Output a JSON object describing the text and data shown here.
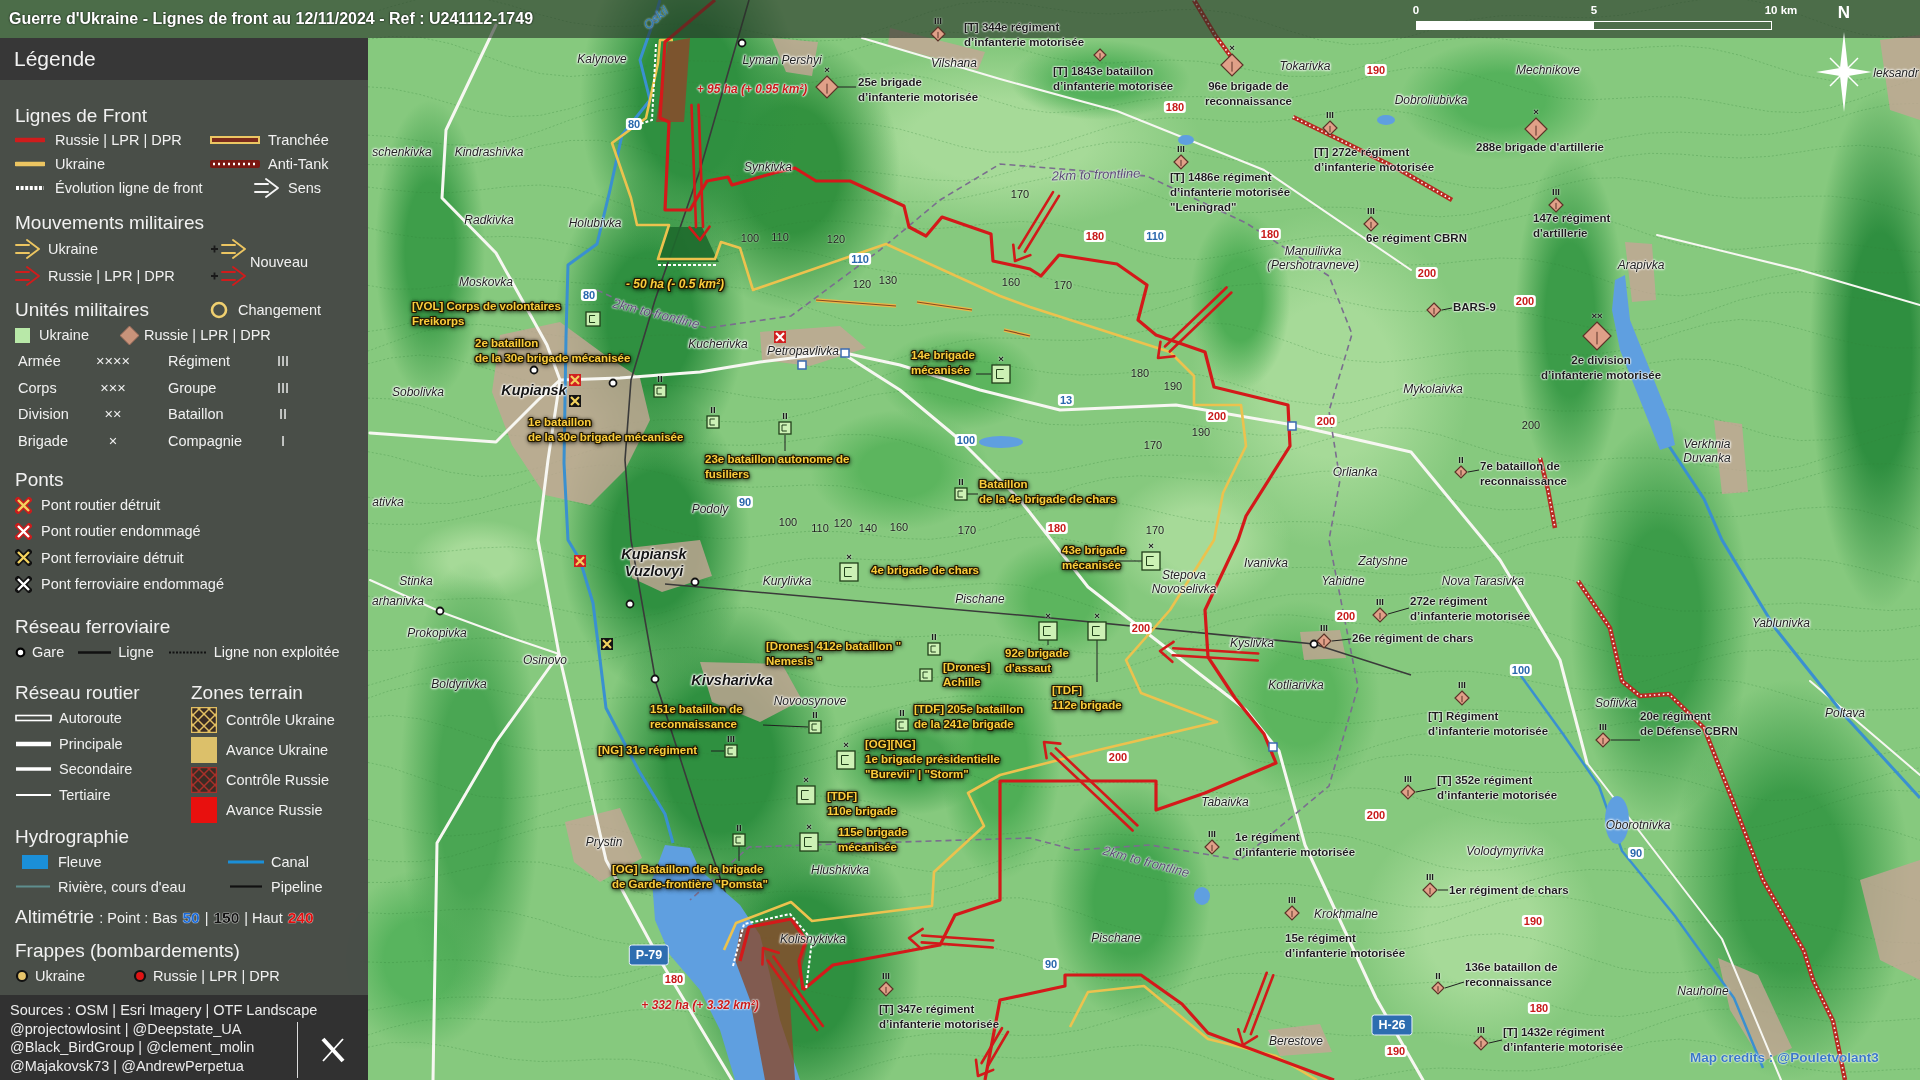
{
  "header": {
    "title": "Guerre d'Ukraine - Lignes de front au 12/11/2024 - Ref : U241112-1749",
    "scale_labels": [
      "0",
      "5",
      "10 km"
    ],
    "north_label": "N"
  },
  "legend": {
    "title": "Légende",
    "front_lines": {
      "heading": "Lignes de Front",
      "items": [
        {
          "label": "Russie | LPR | DPR",
          "kind": "line",
          "color": "#d01c1c"
        },
        {
          "label": "Tranchée",
          "kind": "trench"
        },
        {
          "label": "Ukraine",
          "kind": "line",
          "color": "#ecc561"
        },
        {
          "label": "Anti-Tank",
          "kind": "antitank"
        },
        {
          "label": "Évolution ligne de front",
          "kind": "dotted"
        },
        {
          "label": "Sens",
          "kind": "arrow"
        }
      ]
    },
    "movements": {
      "heading": "Mouvements militaires",
      "items": [
        {
          "label": "Ukraine",
          "color": "#ecc561"
        },
        {
          "label": "Russie | LPR | DPR",
          "color": "#d01c1c"
        }
      ],
      "new_label": "Nouveau"
    },
    "units": {
      "heading": "Unités militaires",
      "change_label": "Changement",
      "sides": [
        {
          "label": "Ukraine",
          "kind": "square"
        },
        {
          "label": "Russie | LPR | DPR",
          "kind": "diamond"
        }
      ],
      "echelons": [
        {
          "name": "Armée",
          "mark": "××××"
        },
        {
          "name": "Régiment",
          "mark": "III"
        },
        {
          "name": "Corps",
          "mark": "×××"
        },
        {
          "name": "Groupe",
          "mark": "III"
        },
        {
          "name": "Division",
          "mark": "××"
        },
        {
          "name": "Bataillon",
          "mark": "II"
        },
        {
          "name": "Brigade",
          "mark": "×"
        },
        {
          "name": "Compagnie",
          "mark": "I"
        }
      ]
    },
    "bridges": {
      "heading": "Ponts",
      "items": [
        {
          "label": "Pont routier détruit",
          "kind": "road",
          "destroyed": true
        },
        {
          "label": "Pont routier endommagé",
          "kind": "road",
          "destroyed": false
        },
        {
          "label": "Pont ferroviaire détruit",
          "kind": "rail",
          "destroyed": true
        },
        {
          "label": "Pont ferroviaire endommagé",
          "kind": "rail",
          "destroyed": false
        }
      ]
    },
    "railway": {
      "heading": "Réseau ferroviaire",
      "items": [
        {
          "label": "Gare",
          "kind": "station"
        },
        {
          "label": "Ligne",
          "kind": "line"
        },
        {
          "label": "Ligne non exploitée",
          "kind": "dashed"
        }
      ]
    },
    "roads": {
      "heading": "Réseau routier",
      "items": [
        {
          "label": "Autoroute",
          "kind": "motorway"
        },
        {
          "label": "Principale",
          "kind": "primary"
        },
        {
          "label": "Secondaire",
          "kind": "secondary"
        },
        {
          "label": "Tertiaire",
          "kind": "tertiary"
        }
      ]
    },
    "zones": {
      "heading": "Zones terrain",
      "items": [
        {
          "label": "Contrôle Ukraine",
          "kind": "hatched",
          "color": "#e2bf62"
        },
        {
          "label": "Avance Ukraine",
          "kind": "solid",
          "color": "#dcc06a"
        },
        {
          "label": "Contrôle Russie",
          "kind": "hatched",
          "color": "#a8302a"
        },
        {
          "label": "Avance Russie",
          "kind": "solid",
          "color": "#e8100e"
        }
      ]
    },
    "hydro": {
      "heading": "Hydrographie",
      "items": [
        {
          "label": "Fleuve",
          "kind": "area"
        },
        {
          "label": "Canal",
          "kind": "canal"
        },
        {
          "label": "Rivière, cours d'eau",
          "kind": "stream"
        },
        {
          "label": "Pipeline",
          "kind": "pipeline"
        }
      ]
    },
    "elevation": {
      "heading": "Altimétrie",
      "parts": [
        {
          "text": ": Point : Bas",
          "kind": "plain"
        },
        {
          "text": "50",
          "kind": "low"
        },
        {
          "text": "|",
          "kind": "plain"
        },
        {
          "text": "150",
          "kind": "mid"
        },
        {
          "text": "| Haut",
          "kind": "plain"
        },
        {
          "text": "240",
          "kind": "high"
        }
      ]
    },
    "strikes": {
      "heading": "Frappes (bombardements)",
      "items": [
        {
          "label": "Ukraine",
          "color": "#e6c46a"
        },
        {
          "label": "Russie | LPR | DPR",
          "color": "#e01414"
        }
      ]
    },
    "sources": {
      "text": "Sources : OSM | Esri Imagery | OTF Landscape",
      "credits": [
        "@projectowlosint | @Deepstate_UA",
        "@Black_BirdGroup | @clement_molin",
        "@Majakovsk73 | @AndrewPerpetua"
      ]
    }
  },
  "map": {
    "places": [
      {
        "name": "Kalynove",
        "kind": "village"
      },
      {
        "name": "Lyman Pershyi",
        "kind": "village"
      },
      {
        "name": "Vilshana",
        "kind": "village"
      },
      {
        "name": "Tokarivka",
        "kind": "village"
      },
      {
        "name": "Mechnikove",
        "kind": "village"
      },
      {
        "name": "leksandr",
        "kind": "village"
      },
      {
        "name": "Dobroliubivka",
        "kind": "village"
      },
      {
        "name": "schenkivka",
        "kind": "village"
      },
      {
        "name": "Kindrashivka",
        "kind": "village"
      },
      {
        "name": "Synkivka",
        "kind": "village"
      },
      {
        "name": "Radkivka",
        "kind": "village"
      },
      {
        "name": "Holubivka",
        "kind": "village"
      },
      {
        "name": "Manuilivka\n(Pershotravneve)",
        "kind": "village"
      },
      {
        "name": "Arapivka",
        "kind": "village"
      },
      {
        "name": "Moskovka",
        "kind": "village"
      },
      {
        "name": "Kucherivka",
        "kind": "village"
      },
      {
        "name": "Petropavlivka",
        "kind": "village"
      },
      {
        "name": "Sobolivka",
        "kind": "village"
      },
      {
        "name": "Kupiansk",
        "kind": "city"
      },
      {
        "name": "Mykolaivka",
        "kind": "village"
      },
      {
        "name": "Verkhnia\nDuvanka",
        "kind": "village"
      },
      {
        "name": "Orlianka",
        "kind": "village"
      },
      {
        "name": "ativka",
        "kind": "village"
      },
      {
        "name": "Podoly",
        "kind": "village"
      },
      {
        "name": "Kupiansk\nVuzlovyi",
        "kind": "city"
      },
      {
        "name": "Ivanivka",
        "kind": "village"
      },
      {
        "name": "Zatyshne",
        "kind": "village"
      },
      {
        "name": "Stinka",
        "kind": "village"
      },
      {
        "name": "Kurylivka",
        "kind": "village"
      },
      {
        "name": "Stepova\nNovoselivka",
        "kind": "village"
      },
      {
        "name": "Yahidne",
        "kind": "village"
      },
      {
        "name": "Nova Tarasivka",
        "kind": "village"
      },
      {
        "name": "arhanivka",
        "kind": "village"
      },
      {
        "name": "Pischane",
        "kind": "village"
      },
      {
        "name": "Yablunivka",
        "kind": "village"
      },
      {
        "name": "Prokopivka",
        "kind": "village"
      },
      {
        "name": "Kyslivka",
        "kind": "village"
      },
      {
        "name": "Osinovo",
        "kind": "village"
      },
      {
        "name": "Boldyrivka",
        "kind": "village"
      },
      {
        "name": "Kivsharivka",
        "kind": "city"
      },
      {
        "name": "Kotliarivka",
        "kind": "village"
      },
      {
        "name": "Novoosynove",
        "kind": "village"
      },
      {
        "name": "Sofiivka",
        "kind": "village"
      },
      {
        "name": "Poltava",
        "kind": "village"
      },
      {
        "name": "Tabaivka",
        "kind": "village"
      },
      {
        "name": "Oborotnivka",
        "kind": "village"
      },
      {
        "name": "Prystin",
        "kind": "village"
      },
      {
        "name": "Volodymyrivka",
        "kind": "village"
      },
      {
        "name": "Hlushkivka",
        "kind": "village"
      },
      {
        "name": "Krokhmalne",
        "kind": "village"
      },
      {
        "name": "Kolisnykivka",
        "kind": "village"
      },
      {
        "name": "Pischane",
        "kind": "village"
      },
      {
        "name": "Nauholne",
        "kind": "village"
      },
      {
        "name": "Berestove",
        "kind": "village"
      }
    ],
    "rivers": [
      {
        "name": "Oskil"
      }
    ],
    "russian_units": [
      {
        "label": "[T] 344e régiment\nd’infanterie motorisée",
        "echelon": "III",
        "kind": "regiment"
      },
      {
        "label": "25e brigade\nd’infanterie motorisée",
        "echelon": "×",
        "kind": "brigade"
      },
      {
        "label": "[T] 1843e bataillon\nd’infanterie motorisée",
        "kind": "battalion"
      },
      {
        "label": "96e brigade de\nreconnaissance",
        "echelon": "×",
        "kind": "brigade"
      },
      {
        "label": "[T] 272e régiment\nd’infanterie motorisée",
        "echelon": "III",
        "kind": "regiment"
      },
      {
        "label": "288e brigade d'artillerie",
        "echelon": "×",
        "kind": "brigade"
      },
      {
        "label": "[T] 1486e régiment\nd’infanterie motorisée\n\"Leningrad\"",
        "echelon": "III",
        "kind": "regiment"
      },
      {
        "label": "6e régiment CBRN",
        "echelon": "III",
        "kind": "regiment"
      },
      {
        "label": "147e régiment\nd'artillerie",
        "echelon": "III",
        "kind": "regiment"
      },
      {
        "label": "BARS-9",
        "kind": "detachment"
      },
      {
        "label": "2e division\nd’infanterie motorisée",
        "echelon": "××",
        "kind": "division"
      },
      {
        "label": "7e bataillon de\nreconnaissance",
        "echelon": "II",
        "kind": "battalion"
      },
      {
        "label": "272e régiment\nd’infanterie motorisée",
        "echelon": "III",
        "kind": "regiment"
      },
      {
        "label": "26e régiment de chars",
        "echelon": "III",
        "kind": "regiment"
      },
      {
        "label": "[T] Régiment\nd’infanterie motorisée",
        "echelon": "III",
        "kind": "regiment"
      },
      {
        "label": "20e régiment\nde Défense CBRN",
        "echelon": "III",
        "kind": "regiment"
      },
      {
        "label": "[T] 352e régiment\nd’infanterie motorisée",
        "echelon": "III",
        "kind": "regiment"
      },
      {
        "label": "1e régiment\nd’infanterie motorisée",
        "echelon": "III",
        "kind": "regiment"
      },
      {
        "label": "1er régiment de chars",
        "echelon": "III",
        "kind": "regiment"
      },
      {
        "label": "15e régiment\nd’infanterie motorisée",
        "echelon": "III",
        "kind": "regiment"
      },
      {
        "label": "136e bataillon de\nreconnaissance",
        "echelon": "II",
        "kind": "battalion"
      },
      {
        "label": "[T] 347e régiment\nd’infanterie motorisée",
        "echelon": "III",
        "kind": "regiment"
      },
      {
        "label": "[T] 1432e régiment\nd’infanterie motorisée",
        "echelon": "III",
        "kind": "regiment"
      }
    ],
    "ukrainian_units": [
      {
        "label": "[VOL] Corps de volontaires\nFreikorps",
        "kind": "detachment"
      },
      {
        "label": "2e bataillon\nde la 30e brigade mécanisée",
        "echelon": "II",
        "kind": "battalion"
      },
      {
        "label": "14e brigade\nmécanisée",
        "echelon": "×",
        "kind": "brigade"
      },
      {
        "label": "1e bataillon\nde la 30e brigade mécanisée",
        "echelon": "II",
        "kind": "battalion"
      },
      {
        "label": "23e bataillon autonome de\nfusiliers",
        "echelon": "II",
        "kind": "battalion"
      },
      {
        "label": "Bataillon\nde la 4e brigade de chars",
        "echelon": "II",
        "kind": "battalion"
      },
      {
        "label": "4e brigade de chars",
        "echelon": "×",
        "kind": "brigade"
      },
      {
        "label": "43e brigade\nmécanisée",
        "echelon": "×",
        "kind": "brigade"
      },
      {
        "label": "[Drones] 412e bataillon \"\nNemesis \"",
        "echelon": "II",
        "kind": "battalion"
      },
      {
        "label": "[Drones]\nAchille",
        "kind": "battalion"
      },
      {
        "label": "92e brigade\nd'assaut",
        "echelon": "×",
        "kind": "brigade"
      },
      {
        "label": "[TDF]\n112e brigade",
        "echelon": "×",
        "kind": "brigade"
      },
      {
        "label": "151e bataillon de\nreconnaissance",
        "echelon": "II",
        "kind": "battalion"
      },
      {
        "label": "[TDF] 205e bataillon\nde la 241e brigade",
        "echelon": "II",
        "kind": "battalion"
      },
      {
        "label": "[NG] 31e régiment",
        "echelon": "III",
        "kind": "regiment"
      },
      {
        "label": "[OG][NG]\n1e brigade présidentielle\n\"Burevii\" | \"Storm\"",
        "echelon": "×",
        "kind": "brigade"
      },
      {
        "label": "[TDF]\n110e brigade",
        "echelon": "×",
        "kind": "brigade"
      },
      {
        "label": "[OG] Bataillon de la brigade\nde Garde-frontière \"Pomsta\"",
        "echelon": "II",
        "kind": "battalion"
      },
      {
        "label": "115e brigade\nmécanisée",
        "echelon": "×",
        "kind": "brigade"
      }
    ],
    "area_changes": [
      {
        "text": "+ 95 ha (+ 0.95 km²)",
        "kind": "russia"
      },
      {
        "text": "- 50 ha (- 0.5 km²)",
        "kind": "ukraine"
      },
      {
        "text": "+ 332 ha (+ 3.32 km²)",
        "kind": "russia"
      }
    ],
    "distance_labels": [
      "2km to frontline",
      "2km to frontline",
      "2km to frontline"
    ],
    "elevations": [
      {
        "value": "190",
        "kind": "high"
      },
      {
        "value": "180",
        "kind": "high"
      },
      {
        "value": "80",
        "kind": "low"
      },
      {
        "value": "170",
        "kind": "mid"
      },
      {
        "value": "100",
        "kind": "mid"
      },
      {
        "value": "110",
        "kind": "mid"
      },
      {
        "value": "120",
        "kind": "mid"
      },
      {
        "value": "180",
        "kind": "high"
      },
      {
        "value": "110",
        "kind": "low"
      },
      {
        "value": "180",
        "kind": "high"
      },
      {
        "value": "110",
        "kind": "low"
      },
      {
        "value": "200",
        "kind": "high"
      },
      {
        "value": "120",
        "kind": "mid"
      },
      {
        "value": "130",
        "kind": "mid"
      },
      {
        "value": "160",
        "kind": "mid"
      },
      {
        "value": "170",
        "kind": "mid"
      },
      {
        "value": "80",
        "kind": "low"
      },
      {
        "value": "200",
        "kind": "high"
      },
      {
        "value": "180",
        "kind": "mid"
      },
      {
        "value": "190",
        "kind": "mid"
      },
      {
        "value": "13",
        "kind": "low"
      },
      {
        "value": "200",
        "kind": "high"
      },
      {
        "value": "200",
        "kind": "high"
      },
      {
        "value": "200",
        "kind": "mid"
      },
      {
        "value": "190",
        "kind": "mid"
      },
      {
        "value": "100",
        "kind": "low"
      },
      {
        "value": "170",
        "kind": "mid"
      },
      {
        "value": "90",
        "kind": "low"
      },
      {
        "value": "100",
        "kind": "mid"
      },
      {
        "value": "110",
        "kind": "mid"
      },
      {
        "value": "120",
        "kind": "mid"
      },
      {
        "value": "140",
        "kind": "mid"
      },
      {
        "value": "160",
        "kind": "mid"
      },
      {
        "value": "170",
        "kind": "mid"
      },
      {
        "value": "180",
        "kind": "high"
      },
      {
        "value": "170",
        "kind": "mid"
      },
      {
        "value": "200",
        "kind": "high"
      },
      {
        "value": "200",
        "kind": "high"
      },
      {
        "value": "100",
        "kind": "low"
      },
      {
        "value": "200",
        "kind": "high"
      },
      {
        "value": "200",
        "kind": "high"
      },
      {
        "value": "90",
        "kind": "low"
      },
      {
        "value": "190",
        "kind": "high"
      },
      {
        "value": "90",
        "kind": "low"
      },
      {
        "value": "180",
        "kind": "high"
      },
      {
        "value": "180",
        "kind": "high"
      },
      {
        "value": "190",
        "kind": "high"
      }
    ],
    "road_numbers": [
      "P-79",
      "H-26"
    ],
    "bridges": [
      {
        "kind": "road",
        "destroyed": false
      },
      {
        "kind": "road",
        "destroyed": true
      },
      {
        "kind": "rail",
        "destroyed": true
      },
      {
        "kind": "road",
        "destroyed": true
      },
      {
        "kind": "rail",
        "destroyed": true
      }
    ],
    "credits": "Map credits : @Pouletvolant3"
  }
}
